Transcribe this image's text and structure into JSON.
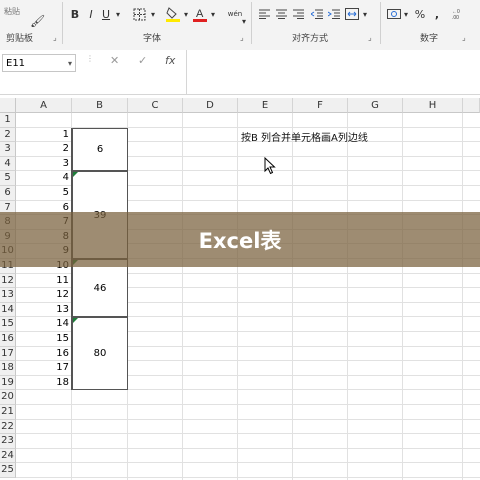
{
  "ribbon": {
    "clipboard": {
      "label": "剪贴板",
      "paste_label": "粘贴"
    },
    "font": {
      "label": "字体",
      "bold": "B",
      "italic": "I",
      "underline": "U",
      "wen": "wén"
    },
    "alignment": {
      "label": "对齐方式"
    },
    "number": {
      "label": "数字",
      "percent": "%",
      "comma": ","
    }
  },
  "formula_bar": {
    "name_box": "E11",
    "cancel": "✕",
    "enter": "✓",
    "fx": "fx",
    "value": ""
  },
  "columns": [
    "A",
    "B",
    "C",
    "D",
    "E",
    "F",
    "G",
    "H"
  ],
  "rows": [
    "1",
    "2",
    "3",
    "4",
    "5",
    "6",
    "7",
    "8",
    "9",
    "10",
    "11",
    "12",
    "13",
    "14",
    "15",
    "16",
    "17",
    "18",
    "19",
    "20",
    "21",
    "22",
    "23",
    "24",
    "25"
  ],
  "col_a_values": [
    "1",
    "2",
    "3",
    "4",
    "5",
    "6",
    "7",
    "8",
    "9",
    "10",
    "11",
    "12",
    "13",
    "14",
    "15",
    "16",
    "17",
    "18"
  ],
  "merged_b": [
    {
      "value": "6"
    },
    {
      "value": "39"
    },
    {
      "value": "46"
    },
    {
      "value": "80"
    }
  ],
  "annotation": "按B 列合并单元格画A列边线",
  "banner": "Excel表",
  "colors": {
    "accent_green": "#1e7d3a",
    "banner": "#785f3c",
    "grid": "#e1e1e1"
  }
}
